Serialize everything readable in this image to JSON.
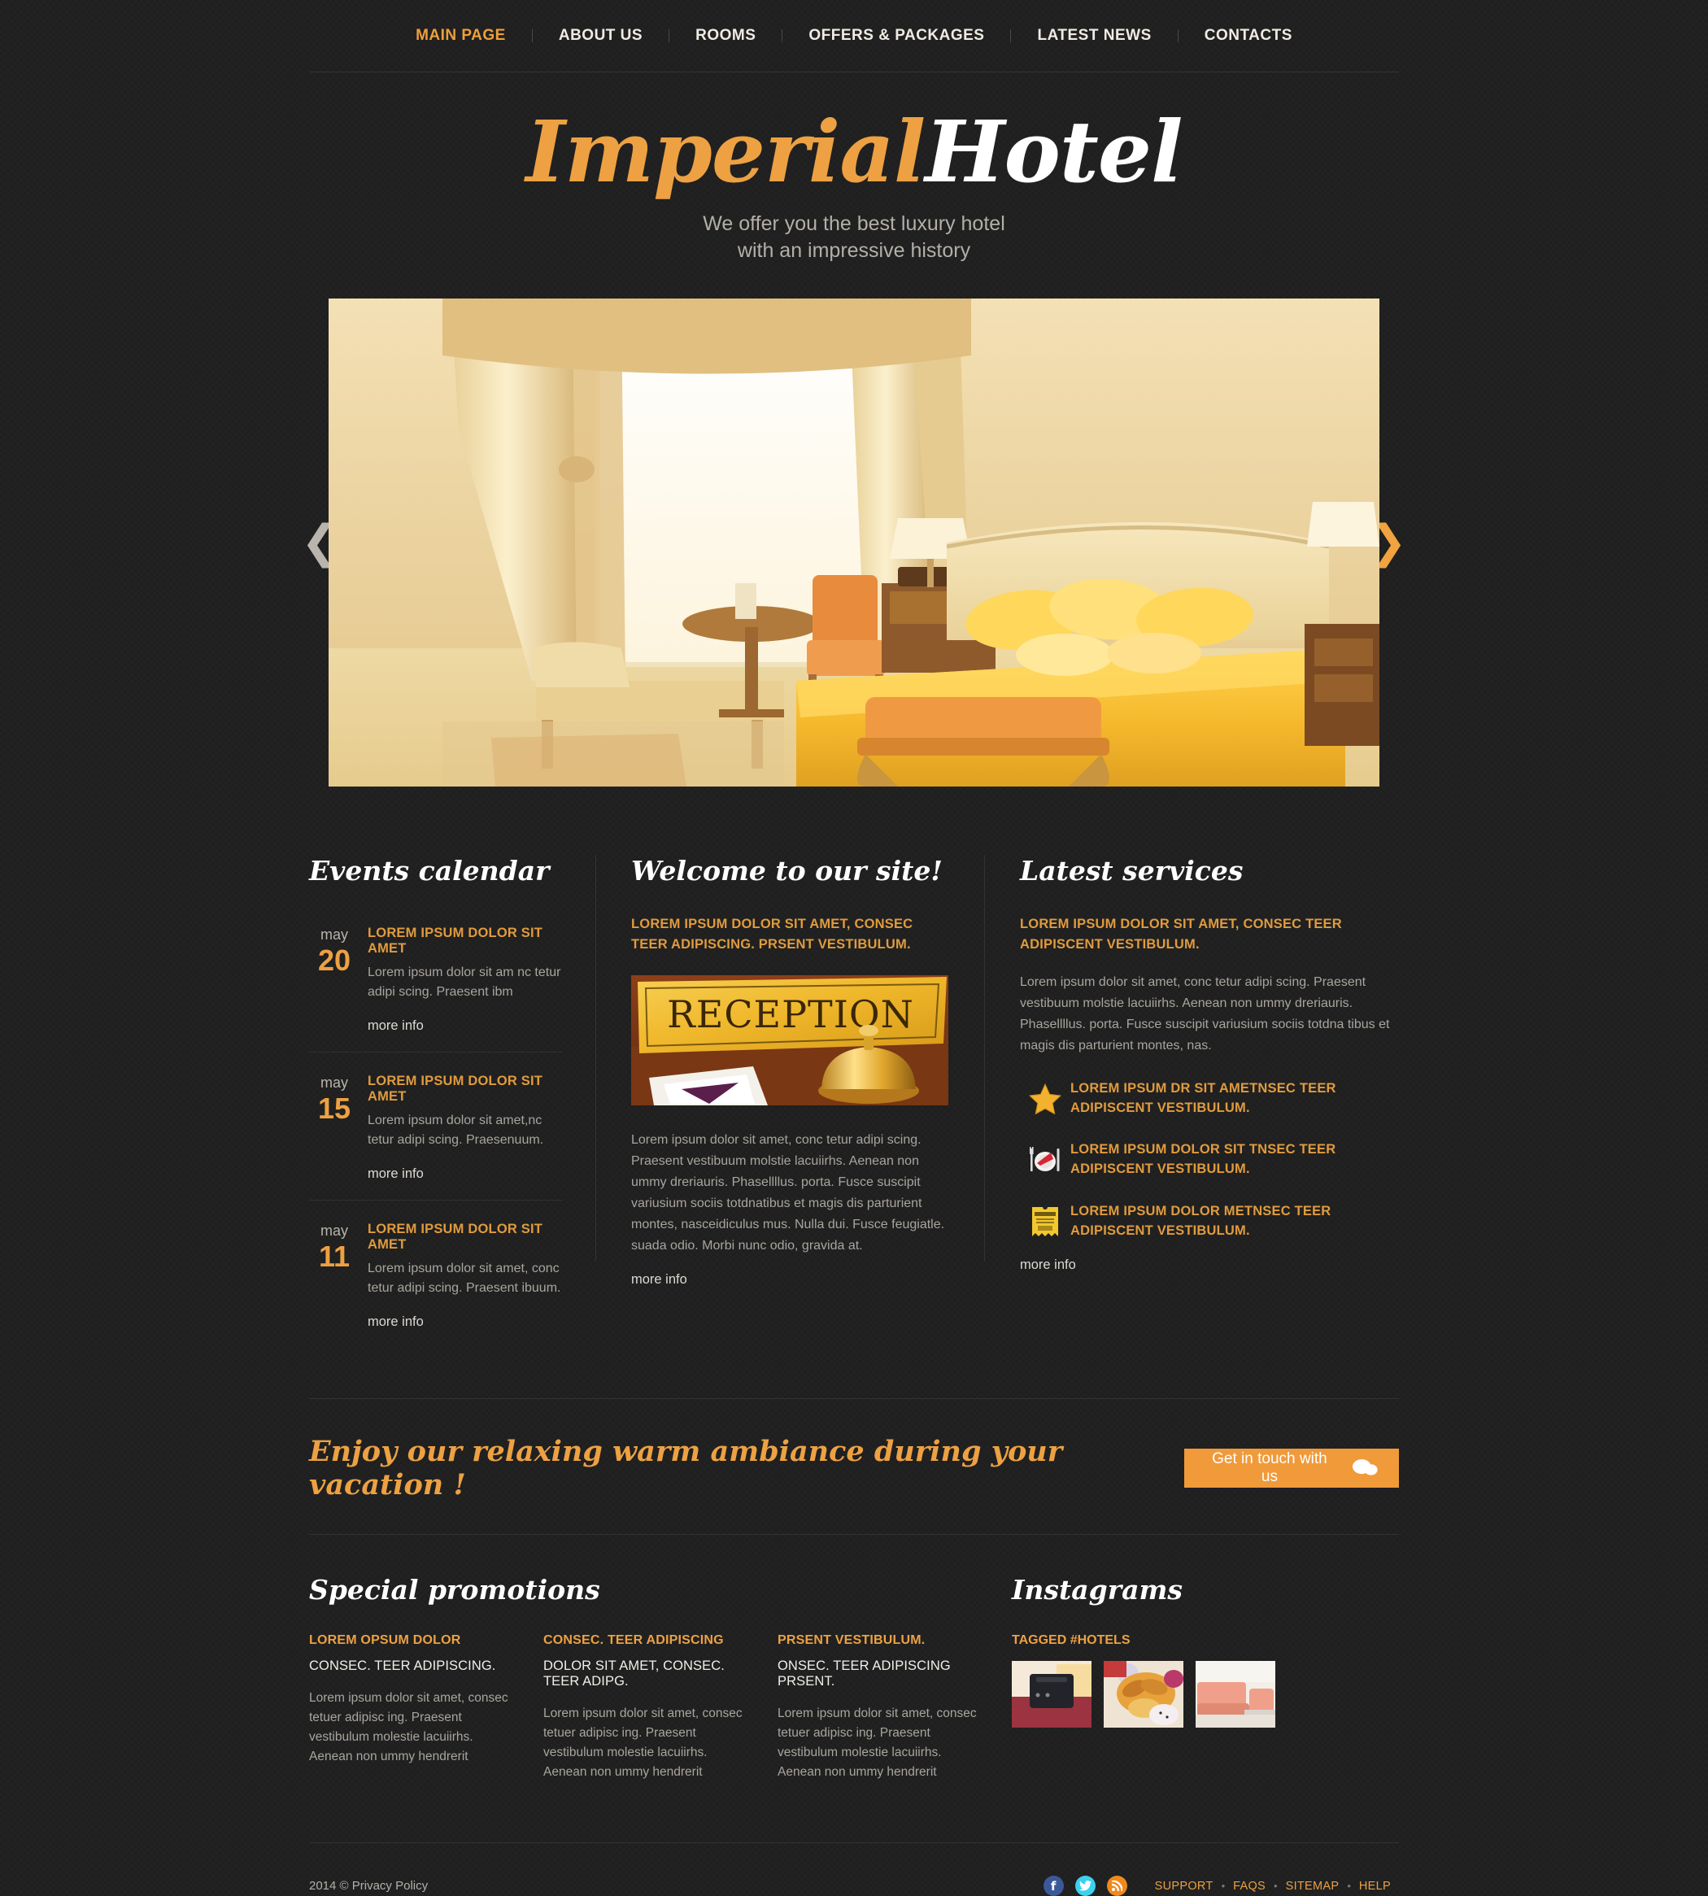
{
  "nav": {
    "items": [
      {
        "label": "MAIN PAGE",
        "active": true
      },
      {
        "label": "ABOUT US",
        "active": false
      },
      {
        "label": "ROOMS",
        "active": false
      },
      {
        "label": "OFFERS & PACKAGES",
        "active": false
      },
      {
        "label": "LATEST NEWS",
        "active": false
      },
      {
        "label": "CONTACTS",
        "active": false
      }
    ]
  },
  "header": {
    "logo_first": "Imperial",
    "logo_second": "Hotel",
    "tagline_line1": "We offer you the best luxury hotel",
    "tagline_line2": "with an impressive history"
  },
  "slider": {
    "prev_icon": "chevron-left-icon",
    "next_icon": "chevron-right-icon",
    "prev_glyph": "❮",
    "next_glyph": "❯",
    "alt": "Luxury hotel bedroom with golden bedding, drapes and chaise lounge"
  },
  "events": {
    "title": "Events calendar",
    "items": [
      {
        "month": "may",
        "day": "20",
        "title": "LOREM IPSUM DOLOR SIT AMET",
        "text": "Lorem ipsum dolor sit am nc tetur adipi scing. Praesent ibm",
        "more": "more info"
      },
      {
        "month": "may",
        "day": "15",
        "title": "LOREM IPSUM DOLOR SIT AMET",
        "text": "Lorem ipsum dolor sit amet,nc tetur adipi scing. Praesenuum.",
        "more": "more info"
      },
      {
        "month": "may",
        "day": "11",
        "title": "LOREM IPSUM DOLOR SIT AMET",
        "text": "Lorem ipsum dolor sit amet, conc tetur adipi scing. Praesent ibuum.",
        "more": "more info"
      }
    ]
  },
  "welcome": {
    "title": "Welcome to our site!",
    "lead": "LOREM IPSUM DOLOR SIT AMET, CONSEC TEER ADIPISCING. PRSENT VESTIBULUM.",
    "image_alt": "Reception desk sign with a brass service bell",
    "body": "Lorem ipsum dolor sit amet, conc tetur adipi scing. Praesent vestibuum molstie lacuiirhs. Aenean non ummy dreriauris. Phasellllus. porta. Fusce suscipit variusium sociis totdnatibus et magis dis parturient montes, nasceidiculus mus. Nulla dui. Fusce feugiatle. suada odio. Morbi nunc odio, gravida at.",
    "more": "more info"
  },
  "services": {
    "title": "Latest services",
    "lead": "LOREM IPSUM DOLOR SIT AMET, CONSEC TEER ADIPISCENT VESTIBULUM.",
    "body": "Lorem ipsum dolor sit amet, conc tetur adipi scing. Praesent vestibuum molstie lacuiirhs. Aenean non ummy dreriauris. Phasellllus. porta. Fusce suscipit variusium sociis totdna tibus et magis dis parturient montes, nas.",
    "items": [
      {
        "icon": "star-icon",
        "text": "LOREM IPSUM DR SIT AMETNSEC TEER ADIPISCENT VESTIBULUM."
      },
      {
        "icon": "dining-plate-icon",
        "text": "LOREM IPSUM DOLOR SIT TNSEC TEER ADIPISCENT VESTIBULUM."
      },
      {
        "icon": "vacation-ticket-icon",
        "text": "LOREM IPSUM DOLOR METNSEC TEER ADIPISCENT VESTIBULUM."
      }
    ],
    "more": "more info"
  },
  "cta": {
    "headline": "Enjoy our relaxing warm ambiance during your vacation !",
    "button_label": "Get in touch  with us",
    "button_icon": "speech-bubbles-icon"
  },
  "promotions": {
    "title": "Special promotions",
    "items": [
      {
        "heading": "LOREM OPSUM DOLOR",
        "subheading": "CONSEC. TEER ADIPISCING.",
        "text": "Lorem ipsum dolor sit amet, consec tetuer adipisc ing. Praesent vestibulum molestie lacuiirhs. Aenean non ummy hendrerit"
      },
      {
        "heading": "CONSEC. TEER ADIPISCING",
        "subheading": "DOLOR SIT AMET, CONSEC. TEER ADIPG.",
        "text": "Lorem ipsum dolor sit amet, consec tetuer adipisc ing. Praesent vestibulum molestie lacuiirhs. Aenean non ummy hendrerit"
      },
      {
        "heading": "PRSENT VESTIBULUM.",
        "subheading": "ONSEC. TEER ADIPISCING PRSENT.",
        "text": "Lorem ipsum dolor sit amet, consec tetuer adipisc ing. Praesent vestibulum molestie lacuiirhs. Aenean non ummy hendrerit"
      }
    ]
  },
  "instagram": {
    "title": "Instagrams",
    "heading": "TAGGED #HOTELS",
    "thumbs": [
      {
        "alt": "Black suitcase on red patterned hotel carpet"
      },
      {
        "alt": "Plate of croissants and tropical fruit breakfast"
      },
      {
        "alt": "Pale pink sofa in a bright lounge"
      }
    ]
  },
  "footer": {
    "copyright": "2014 © Privacy Policy",
    "social": [
      {
        "name": "facebook-icon",
        "glyph": "f",
        "color": "#3b5998"
      },
      {
        "name": "twitter-icon",
        "glyph": "✉",
        "color": "#3ad2ef"
      },
      {
        "name": "rss-icon",
        "glyph": "◔",
        "color": "#f0891b"
      }
    ],
    "links": [
      "SUPPORT",
      "FAQS",
      "SITEMAP",
      "HELP"
    ],
    "separator": "•"
  },
  "colors": {
    "accent": "#eda142",
    "background": "#232322",
    "text": "#a9a59e",
    "heading": "#ffffff",
    "cta_button": "#f09a39"
  }
}
